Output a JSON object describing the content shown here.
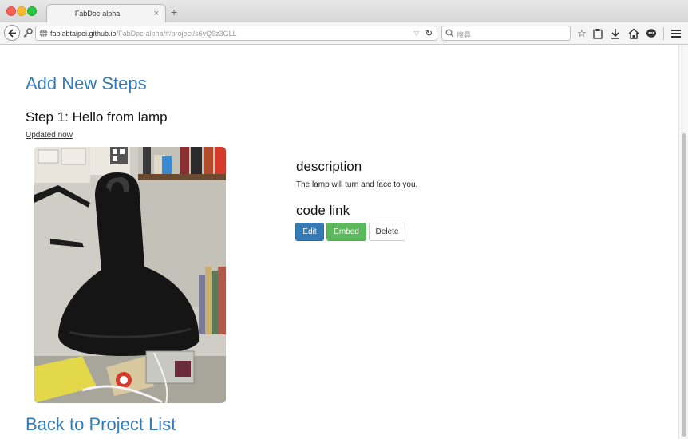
{
  "browser": {
    "tab_title": "FabDoc-alpha",
    "tab_close": "×",
    "new_tab": "+",
    "url_host": "fablabtaipei.github.io",
    "url_path": "/FabDoc-alpha/#/project/s6yQ9z3GLL",
    "url_dropdown": "▽",
    "reload": "↻",
    "search_placeholder": "搜尋",
    "icons": [
      "back-icon",
      "key-icon",
      "globe-icon",
      "search-icon",
      "star-icon",
      "clipboard-icon",
      "download-icon",
      "home-icon",
      "chat-icon",
      "menu-icon"
    ]
  },
  "page": {
    "add_steps_title": "Add New Steps",
    "step_title": "Step 1: Hello from lamp",
    "updated": "Updated now",
    "description_heading": "description",
    "description_text": "The lamp will turn and face to you.",
    "code_link_heading": "code link",
    "buttons": {
      "edit": "Edit",
      "embed": "Embed",
      "delete": "Delete"
    },
    "back_link": "Back to Project List"
  },
  "colors": {
    "link": "#337ab7",
    "primary_button": "#337ab7",
    "success_button": "#5cb85c",
    "default_button_border": "#cccccc"
  }
}
